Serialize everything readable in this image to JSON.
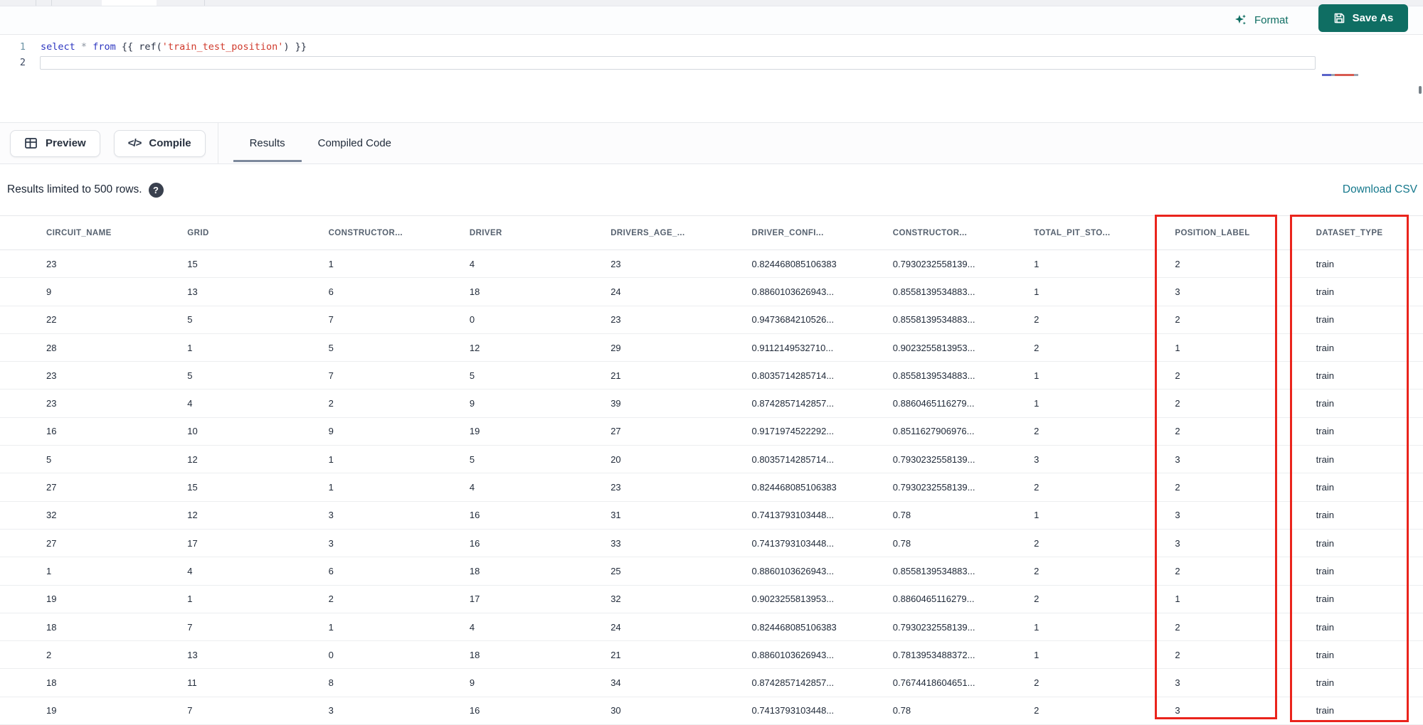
{
  "header": {
    "format_label": "Format",
    "save_as_label": "Save As"
  },
  "editor": {
    "lines": [
      {
        "number": "1",
        "current": false,
        "tokens": [
          {
            "text": "select",
            "type": "keyword"
          },
          {
            "text": " ",
            "type": "plain"
          },
          {
            "text": "*",
            "type": "operator"
          },
          {
            "text": " ",
            "type": "plain"
          },
          {
            "text": "from",
            "type": "keyword"
          },
          {
            "text": " {{ ref(",
            "type": "plain"
          },
          {
            "text": "'train_test_position'",
            "type": "string"
          },
          {
            "text": ") }}",
            "type": "plain"
          }
        ]
      },
      {
        "number": "2",
        "current": true,
        "tokens": []
      }
    ]
  },
  "toolbar": {
    "preview_label": "Preview",
    "compile_label": "Compile",
    "compile_glyph": "</>",
    "tabs": [
      {
        "label": "Results",
        "active": true
      },
      {
        "label": "Compiled Code",
        "active": false
      }
    ]
  },
  "results_bar": {
    "limit_text": "Results limited to 500 rows.",
    "help_glyph": "?",
    "download_label": "Download CSV"
  },
  "table": {
    "columns": [
      "CIRCUIT_NAME",
      "GRID",
      "CONSTRUCTOR...",
      "DRIVER",
      "DRIVERS_AGE_...",
      "DRIVER_CONFI...",
      "CONSTRUCTOR...",
      "TOTAL_PIT_STO...",
      "POSITION_LABEL",
      "DATASET_TYPE"
    ],
    "highlighted_columns": [
      "POSITION_LABEL",
      "DATASET_TYPE"
    ],
    "rows": [
      [
        "23",
        "15",
        "1",
        "4",
        "23",
        "0.824468085106383",
        "0.7930232558139...",
        "1",
        "2",
        "train"
      ],
      [
        "9",
        "13",
        "6",
        "18",
        "24",
        "0.8860103626943...",
        "0.8558139534883...",
        "1",
        "3",
        "train"
      ],
      [
        "22",
        "5",
        "7",
        "0",
        "23",
        "0.9473684210526...",
        "0.8558139534883...",
        "2",
        "2",
        "train"
      ],
      [
        "28",
        "1",
        "5",
        "12",
        "29",
        "0.9112149532710...",
        "0.9023255813953...",
        "2",
        "1",
        "train"
      ],
      [
        "23",
        "5",
        "7",
        "5",
        "21",
        "0.8035714285714...",
        "0.8558139534883...",
        "1",
        "2",
        "train"
      ],
      [
        "23",
        "4",
        "2",
        "9",
        "39",
        "0.8742857142857...",
        "0.8860465116279...",
        "1",
        "2",
        "train"
      ],
      [
        "16",
        "10",
        "9",
        "19",
        "27",
        "0.9171974522292...",
        "0.8511627906976...",
        "2",
        "2",
        "train"
      ],
      [
        "5",
        "12",
        "1",
        "5",
        "20",
        "0.8035714285714...",
        "0.7930232558139...",
        "3",
        "3",
        "train"
      ],
      [
        "27",
        "15",
        "1",
        "4",
        "23",
        "0.824468085106383",
        "0.7930232558139...",
        "2",
        "2",
        "train"
      ],
      [
        "32",
        "12",
        "3",
        "16",
        "31",
        "0.7413793103448...",
        "0.78",
        "1",
        "3",
        "train"
      ],
      [
        "27",
        "17",
        "3",
        "16",
        "33",
        "0.7413793103448...",
        "0.78",
        "2",
        "3",
        "train"
      ],
      [
        "1",
        "4",
        "6",
        "18",
        "25",
        "0.8860103626943...",
        "0.8558139534883...",
        "2",
        "2",
        "train"
      ],
      [
        "19",
        "1",
        "2",
        "17",
        "32",
        "0.9023255813953...",
        "0.8860465116279...",
        "2",
        "1",
        "train"
      ],
      [
        "18",
        "7",
        "1",
        "4",
        "24",
        "0.824468085106383",
        "0.7930232558139...",
        "1",
        "2",
        "train"
      ],
      [
        "2",
        "13",
        "0",
        "18",
        "21",
        "0.8860103626943...",
        "0.7813953488372...",
        "1",
        "2",
        "train"
      ],
      [
        "18",
        "11",
        "8",
        "9",
        "34",
        "0.8742857142857...",
        "0.7674418604651...",
        "2",
        "3",
        "train"
      ],
      [
        "19",
        "7",
        "3",
        "16",
        "30",
        "0.7413793103448...",
        "0.78",
        "2",
        "3",
        "train"
      ]
    ]
  },
  "colors": {
    "accent_teal": "#0f6e63",
    "link_teal": "#15788c",
    "annotation_red": "#ea241c",
    "tab_underline": "#7d899c",
    "keyword_blue": "#2d36c0",
    "string_red": "#d03a2c"
  }
}
